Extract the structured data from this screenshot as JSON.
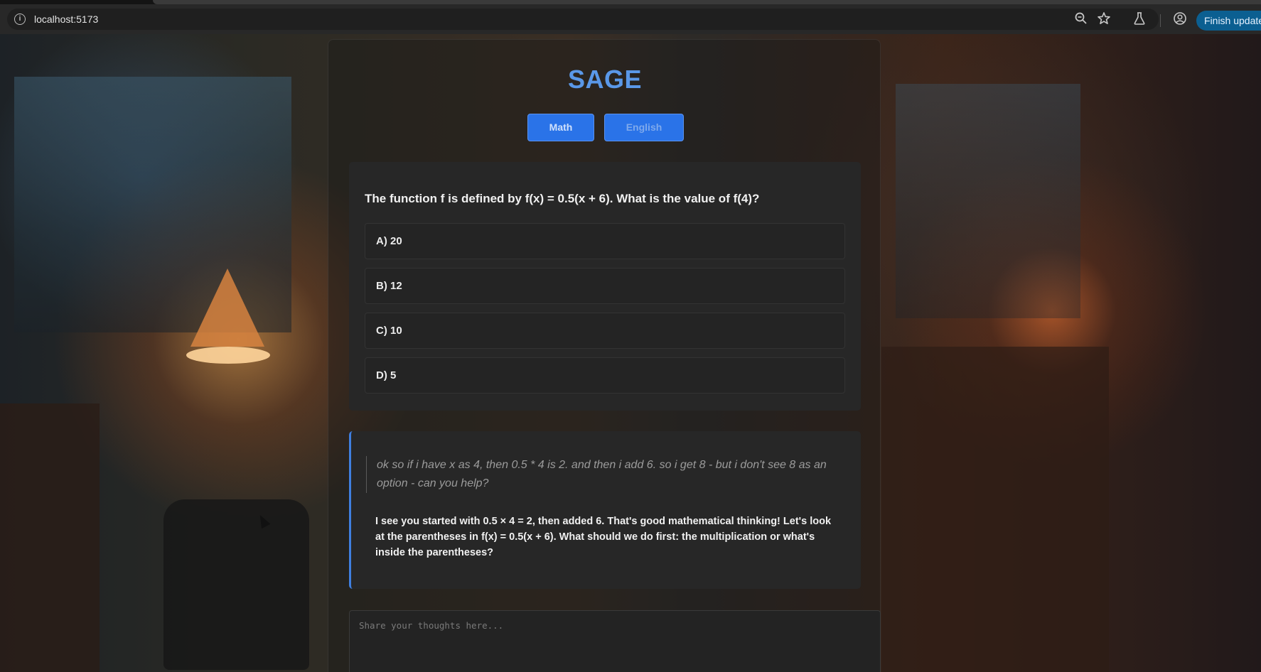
{
  "browser": {
    "url": "localhost:5173",
    "site_info_icon": "info-icon",
    "zoom_icon": "zoom-out-icon",
    "bookmark_icon": "star-icon",
    "labs_icon": "flask-icon",
    "profile_icon": "profile-icon",
    "update_button": "Finish update"
  },
  "app": {
    "title": "SAGE",
    "tabs": [
      {
        "label": "Math"
      },
      {
        "label": "English"
      }
    ],
    "question": {
      "text": "The function f is defined by f(x) = 0.5(x + 6). What is the value of f(4)?",
      "options": [
        {
          "label": "A) 20"
        },
        {
          "label": "B) 12"
        },
        {
          "label": "C) 10"
        },
        {
          "label": "D) 5"
        }
      ]
    },
    "conversation": {
      "student": "ok so if i have x as 4, then 0.5 * 4 is 2. and then i add 6. so i get 8 - but i don't see 8 as an option - can you help?",
      "tutor": "I see you started with 0.5 × 4 = 2, then added 6. That's good mathematical thinking! Let's look at the parentheses in f(x) = 0.5(x + 6). What should we do first: the multiplication or what's inside the parentheses?"
    },
    "input": {
      "placeholder": "Share your thoughts here...",
      "value": ""
    }
  },
  "colors": {
    "accent": "#2a73e8",
    "title": "#5a98e8",
    "card": "#272727",
    "update_button": "#0b5f91"
  }
}
